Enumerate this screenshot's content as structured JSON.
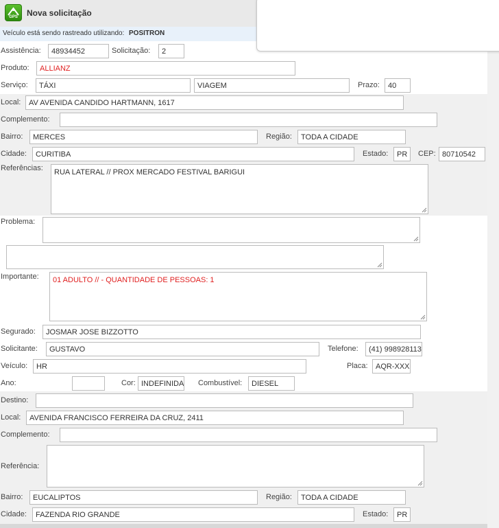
{
  "header": {
    "title": "Nova solicitação",
    "icon_text": "GPS"
  },
  "tracking": {
    "text": "Veículo está sendo rastreado utilizando:",
    "system": "POSITRON"
  },
  "form": {
    "assistencia": {
      "label": "Assistência:",
      "value": "48934452"
    },
    "solicitacao": {
      "label": "Solicitação:",
      "value": "2"
    },
    "produto": {
      "label": "Produto:",
      "value": "ALLIANZ"
    },
    "servico": {
      "label": "Serviço:",
      "value": "TÁXI",
      "value2": "VIAGEM"
    },
    "prazo": {
      "label": "Prazo:",
      "value": "40"
    },
    "local": {
      "label": "Local:",
      "value": "AV AVENIDA CANDIDO HARTMANN, 1617"
    },
    "complemento": {
      "label": "Complemento:",
      "value": ""
    },
    "bairro": {
      "label": "Bairro:",
      "value": "MERCES"
    },
    "regiao": {
      "label": "Região:",
      "value": "TODA A CIDADE"
    },
    "cidade": {
      "label": "Cidade:",
      "value": "CURITIBA"
    },
    "estado": {
      "label": "Estado:",
      "value": "PR"
    },
    "cep": {
      "label": "CEP:",
      "value": "80710542"
    },
    "referencias": {
      "label": "Referências:",
      "value": "RUA LATERAL // PROX MERCADO FESTIVAL BARIGUI"
    },
    "problema": {
      "label": "Problema:",
      "value": ""
    },
    "problema_extra": {
      "value": ""
    },
    "importante": {
      "label": "Importante:",
      "value": "01 ADULTO // - QUANTIDADE DE PESSOAS: 1"
    },
    "segurado": {
      "label": "Segurado:",
      "value": "JOSMAR JOSE BIZZOTTO"
    },
    "solicitante": {
      "label": "Solicitante:",
      "value": "GUSTAVO"
    },
    "telefone": {
      "label": "Telefone:",
      "value": "(41) 998928113"
    },
    "veiculo": {
      "label": "Veículo:",
      "value": "HR"
    },
    "placa": {
      "label": "Placa:",
      "value": "AQR-XXXX"
    },
    "ano": {
      "label": "Ano:",
      "value": ""
    },
    "cor": {
      "label": "Cor:",
      "value": "INDEFINIDA"
    },
    "combustivel": {
      "label": "Combustível:",
      "value": "DIESEL"
    }
  },
  "destino": {
    "destino": {
      "label": "Destino:",
      "value": ""
    },
    "local": {
      "label": "Local:",
      "value": "AVENIDA FRANCISCO FERREIRA DA CRUZ, 2411"
    },
    "complemento": {
      "label": "Complemento:",
      "value": ""
    },
    "referencia": {
      "label": "Referência:",
      "value": ""
    },
    "bairro": {
      "label": "Bairro:",
      "value": "EUCALIPTOS"
    },
    "regiao": {
      "label": "Região:",
      "value": "TODA A CIDADE"
    },
    "cidade": {
      "label": "Cidade:",
      "value": "FAZENDA RIO GRANDE"
    },
    "estado": {
      "label": "Estado:",
      "value": "PR"
    }
  }
}
